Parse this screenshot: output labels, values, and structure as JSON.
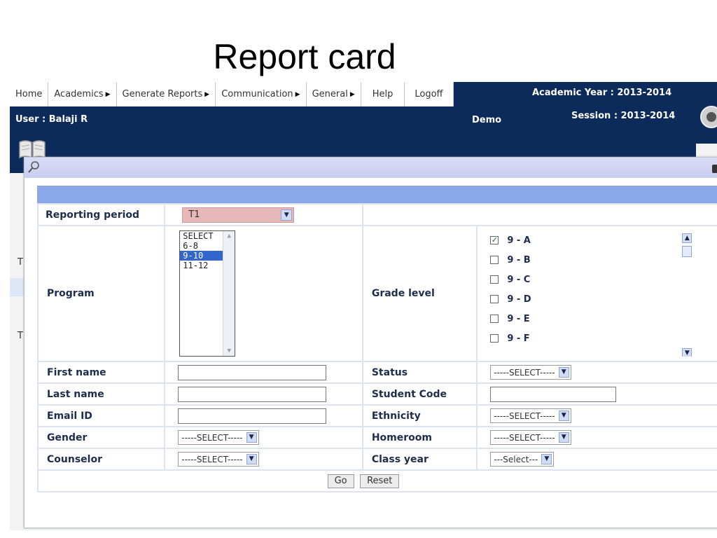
{
  "slide": {
    "title": "Report card"
  },
  "menu": {
    "items": [
      {
        "label": "Home",
        "has_submenu": false
      },
      {
        "label": "Academics",
        "has_submenu": true
      },
      {
        "label": "Generate Reports",
        "has_submenu": true
      },
      {
        "label": "Communication",
        "has_submenu": true
      },
      {
        "label": "General",
        "has_submenu": true
      },
      {
        "label": "Help",
        "has_submenu": false
      },
      {
        "label": "Logoff",
        "has_submenu": false
      }
    ]
  },
  "header": {
    "user": "User : Balaji R",
    "school": "Demo",
    "academic_year": "Academic Year : 2013-2014",
    "session": "Session : 2013-2014"
  },
  "sidebar": {
    "frag1": "T",
    "frag2": "T"
  },
  "form": {
    "reporting_period": {
      "label": "Reporting period",
      "value": "T1"
    },
    "program": {
      "label": "Program",
      "options": [
        "SELECT",
        "6-8",
        "9-10",
        "11-12"
      ],
      "selected": "9-10"
    },
    "grade_level": {
      "label": "Grade level",
      "items": [
        {
          "label": "9 - A",
          "checked": true
        },
        {
          "label": "9 - B",
          "checked": false
        },
        {
          "label": "9 - C",
          "checked": false
        },
        {
          "label": "9 - D",
          "checked": false
        },
        {
          "label": "9 - E",
          "checked": false
        },
        {
          "label": "9 - F",
          "checked": false
        }
      ]
    },
    "first_name": {
      "label": "First name",
      "value": ""
    },
    "last_name": {
      "label": "Last name",
      "value": ""
    },
    "email": {
      "label": "Email ID",
      "value": ""
    },
    "gender": {
      "label": "Gender",
      "value": "-----SELECT-----"
    },
    "counselor": {
      "label": "Counselor",
      "value": "-----SELECT-----"
    },
    "status": {
      "label": "Status",
      "value": "-----SELECT-----"
    },
    "student_code": {
      "label": "Student Code",
      "value": ""
    },
    "ethnicity": {
      "label": "Ethnicity",
      "value": "-----SELECT-----"
    },
    "homeroom": {
      "label": "Homeroom",
      "value": "-----SELECT-----"
    },
    "class_year": {
      "label": "Class year",
      "value": "---Select---"
    },
    "go_label": "Go",
    "reset_label": "Reset"
  },
  "colors": {
    "header_bg": "#0c2a5a",
    "period_select_bg": "#e6b8b8",
    "dialog_bar": "#c9cdf0",
    "blue_strip": "#8aa7e8",
    "selected_option": "#3366cc"
  }
}
